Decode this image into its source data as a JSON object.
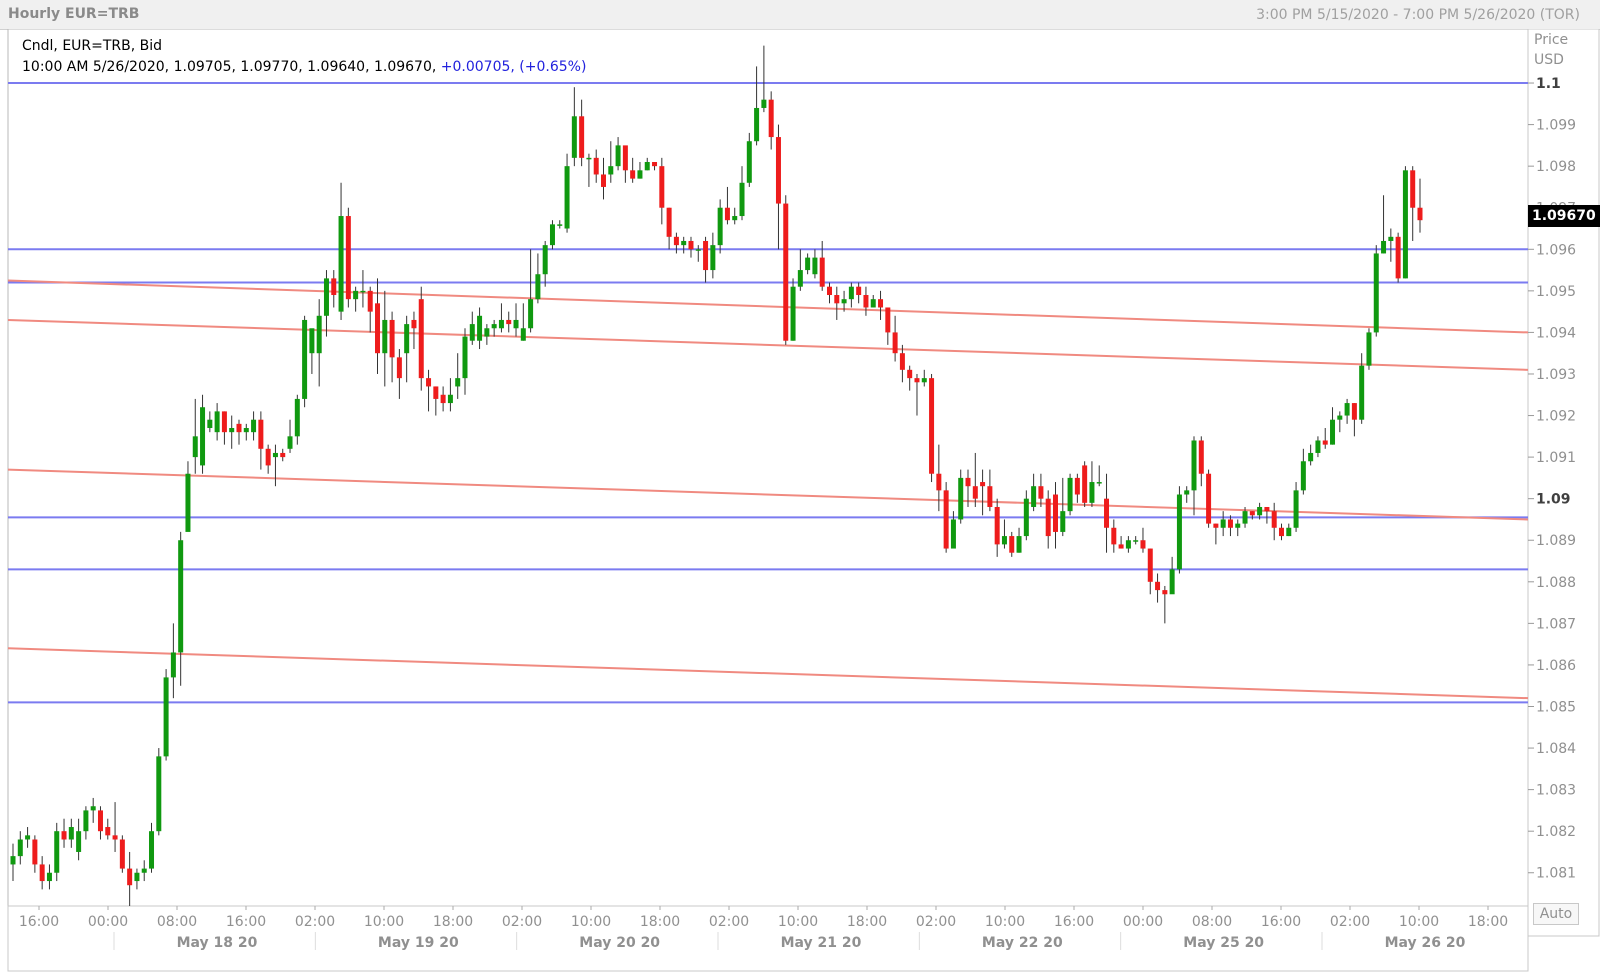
{
  "header": {
    "title": "Hourly EUR=TRB",
    "range": "3:00 PM 5/15/2020 - 7:00 PM 5/26/2020 (TOR)"
  },
  "legend": {
    "line1": "Cndl, EUR=TRB, Bid",
    "line2_prefix": "10:00 AM 5/26/2020, 1.09705, 1.09770, 1.09640, 1.09670, ",
    "line2_change": "+0.00705, (+0.65%)"
  },
  "price_axis": {
    "header_line1": "Price",
    "header_line2": "USD",
    "last_price": "1.09670",
    "auto_label": "Auto"
  },
  "chart_data": {
    "type": "candlestick",
    "symbol": "EUR=TRB",
    "interval": "Hourly",
    "ylim": [
      1.0802,
      1.1013
    ],
    "ytick_values": [
      1.081,
      1.082,
      1.083,
      1.084,
      1.085,
      1.086,
      1.087,
      1.088,
      1.089,
      1.09,
      1.091,
      1.092,
      1.093,
      1.094,
      1.095,
      1.096,
      1.097,
      1.098,
      1.099,
      1.1
    ],
    "ytick_labels": [
      "1.081",
      "1.082",
      "1.083",
      "1.084",
      "1.085",
      "1.086",
      "1.087",
      "1.088",
      "1.089",
      "1.09",
      "1.091",
      "1.092",
      "1.093",
      "1.094",
      "1.095",
      "1.096",
      "1.097",
      "1.098",
      "1.099",
      "1.1"
    ],
    "bold_ticks": [
      "1.09",
      "1.1"
    ],
    "time_ticks": [
      "16:00",
      "00:00",
      "08:00",
      "16:00",
      "02:00",
      "10:00",
      "18:00",
      "02:00",
      "10:00",
      "18:00",
      "02:00",
      "10:00",
      "18:00",
      "02:00",
      "10:00",
      "16:00",
      "00:00",
      "08:00",
      "16:00",
      "02:00",
      "10:00",
      "18:00"
    ],
    "date_labels": [
      "May 18 20",
      "May 19 20",
      "May 20 20",
      "May 21 20",
      "May 22 20",
      "May 25 20",
      "May 26 20"
    ],
    "horizontal_lines": [
      1.1,
      1.096,
      1.0952,
      1.08955,
      1.0883,
      1.0851
    ],
    "trend_lines": [
      {
        "start": 1.09525,
        "end": 1.094
      },
      {
        "start": 1.0943,
        "end": 1.0931
      },
      {
        "start": 1.0907,
        "end": 1.0895
      },
      {
        "start": 1.0864,
        "end": 1.0852
      }
    ],
    "candles": [
      [
        1.0812,
        1.0814,
        1.0808,
        1.0817
      ],
      [
        1.0814,
        1.0818,
        1.0812,
        1.082
      ],
      [
        1.0818,
        1.0819,
        1.0816,
        1.0821
      ],
      [
        1.0818,
        1.0812,
        1.081,
        1.0819
      ],
      [
        1.0812,
        1.0808,
        1.0806,
        1.0814
      ],
      [
        1.0808,
        1.081,
        1.0806,
        1.0812
      ],
      [
        1.081,
        1.082,
        1.0808,
        1.0822
      ],
      [
        1.082,
        1.0818,
        1.0816,
        1.0823
      ],
      [
        1.0818,
        1.0821,
        1.0816,
        1.0823
      ],
      [
        1.0815,
        1.082,
        1.0813,
        1.0823
      ],
      [
        1.082,
        1.0825,
        1.0818,
        1.0826
      ],
      [
        1.0825,
        1.0826,
        1.0822,
        1.0828
      ],
      [
        1.0825,
        1.082,
        1.0818,
        1.0826
      ],
      [
        1.0821,
        1.0819,
        1.0818,
        1.0823
      ],
      [
        1.0819,
        1.0818,
        1.0815,
        1.0827
      ],
      [
        1.0818,
        1.0811,
        1.081,
        1.0819
      ],
      [
        1.0811,
        1.0807,
        1.0802,
        1.0815
      ],
      [
        1.0808,
        1.081,
        1.0806,
        1.0811
      ],
      [
        1.081,
        1.0811,
        1.0808,
        1.0813
      ],
      [
        1.0811,
        1.082,
        1.081,
        1.0822
      ],
      [
        1.082,
        1.0838,
        1.0819,
        1.084
      ],
      [
        1.0838,
        1.0857,
        1.0837,
        1.0859
      ],
      [
        1.0857,
        1.0863,
        1.0852,
        1.087
      ],
      [
        1.0863,
        1.089,
        1.0855,
        1.0892
      ],
      [
        1.0892,
        1.0906,
        1.0903,
        1.0909
      ],
      [
        1.091,
        1.0915,
        1.0906,
        1.0924
      ],
      [
        1.0908,
        1.0922,
        1.0906,
        1.0925
      ],
      [
        1.0917,
        1.0919,
        1.0916,
        1.0921
      ],
      [
        1.0916,
        1.0921,
        1.0914,
        1.0923
      ],
      [
        1.0921,
        1.0916,
        1.0913,
        1.0921
      ],
      [
        1.0916,
        1.0917,
        1.0912,
        1.092
      ],
      [
        1.0918,
        1.0916,
        1.0913,
        1.0919
      ],
      [
        1.0916,
        1.0917,
        1.0914,
        1.0918
      ],
      [
        1.0916,
        1.0919,
        1.0914,
        1.0921
      ],
      [
        1.0919,
        1.0912,
        1.0907,
        1.0921
      ],
      [
        1.0912,
        1.0908,
        1.0906,
        1.0913
      ],
      [
        1.091,
        1.0911,
        1.0903,
        1.0913
      ],
      [
        1.0911,
        1.091,
        1.0909,
        1.0912
      ],
      [
        1.0912,
        1.0915,
        1.0911,
        1.0919
      ],
      [
        1.0915,
        1.0924,
        1.0913,
        1.0925
      ],
      [
        1.0924,
        1.0943,
        1.0922,
        1.0944
      ],
      [
        1.0935,
        1.0941,
        1.093,
        1.0939
      ],
      [
        1.0935,
        1.0944,
        1.0927,
        1.0948
      ],
      [
        1.0944,
        1.0953,
        1.0939,
        1.0955
      ],
      [
        1.0953,
        1.0949,
        1.0946,
        1.0955
      ],
      [
        1.0945,
        1.0968,
        1.0943,
        1.0976
      ],
      [
        1.0968,
        1.0948,
        1.0946,
        1.097
      ],
      [
        1.0948,
        1.095,
        1.0945,
        1.0951
      ],
      [
        1.095,
        1.095,
        1.0946,
        1.0955
      ],
      [
        1.095,
        1.0945,
        1.094,
        1.0951
      ],
      [
        1.0947,
        1.0935,
        1.093,
        1.0953
      ],
      [
        1.0935,
        1.0943,
        1.0927,
        1.095
      ],
      [
        1.0943,
        1.0934,
        1.0928,
        1.0945
      ],
      [
        1.0934,
        1.0929,
        1.0924,
        1.0936
      ],
      [
        1.0935,
        1.0942,
        1.0928,
        1.0944
      ],
      [
        1.0943,
        1.0941,
        1.0936,
        1.0945
      ],
      [
        1.0948,
        1.0929,
        1.0926,
        1.0951
      ],
      [
        1.0929,
        1.0927,
        1.0921,
        1.0931
      ],
      [
        1.0927,
        1.0924,
        1.092,
        1.0927
      ],
      [
        1.0925,
        1.0923,
        1.0921,
        1.0927
      ],
      [
        1.0923,
        1.0925,
        1.0921,
        1.0929
      ],
      [
        1.0927,
        1.0929,
        1.0924,
        1.0935
      ],
      [
        1.0929,
        1.0939,
        1.0925,
        1.0941
      ],
      [
        1.0938,
        1.0942,
        1.0937,
        1.0945
      ],
      [
        1.0938,
        1.0944,
        1.0936,
        1.0946
      ],
      [
        1.0939,
        1.0941,
        1.0937,
        1.0942
      ],
      [
        1.0941,
        1.0942,
        1.0939,
        1.0943
      ],
      [
        1.0941,
        1.0943,
        1.094,
        1.0947
      ],
      [
        1.0943,
        1.0942,
        1.094,
        1.0945
      ],
      [
        1.0941,
        1.0943,
        1.0939,
        1.0947
      ],
      [
        1.0938,
        1.0941,
        1.0938,
        1.0947
      ],
      [
        1.0941,
        1.0948,
        1.094,
        1.096
      ],
      [
        1.0948,
        1.0954,
        1.0947,
        1.0959
      ],
      [
        1.0954,
        1.0961,
        1.0951,
        1.0962
      ],
      [
        1.0961,
        1.0966,
        1.096,
        1.0967
      ],
      [
        1.0966,
        1.0966,
        1.0965,
        1.0967
      ],
      [
        1.0965,
        1.098,
        1.0964,
        1.0983
      ],
      [
        1.0982,
        1.0992,
        1.098,
        1.0999
      ],
      [
        1.0992,
        1.0982,
        1.098,
        1.0996
      ],
      [
        1.0982,
        1.0982,
        1.0975,
        1.0983
      ],
      [
        1.0982,
        1.0978,
        1.0976,
        1.0984
      ],
      [
        1.0978,
        1.0975,
        1.0972,
        1.0982
      ],
      [
        1.0978,
        1.098,
        1.0976,
        1.0986
      ],
      [
        1.098,
        1.0985,
        1.0979,
        1.0987
      ],
      [
        1.0985,
        1.0979,
        1.0976,
        1.0984
      ],
      [
        1.0979,
        1.0977,
        1.0976,
        1.0982
      ],
      [
        1.0977,
        1.0979,
        1.0977,
        1.0981
      ],
      [
        1.0979,
        1.0981,
        1.0979,
        1.0982
      ],
      [
        1.0981,
        1.098,
        1.0979,
        1.0981
      ],
      [
        1.098,
        1.097,
        1.0966,
        1.0982
      ],
      [
        1.097,
        1.0963,
        1.096,
        1.097
      ],
      [
        1.0963,
        1.0961,
        1.0959,
        1.0964
      ],
      [
        1.0961,
        1.0962,
        1.0959,
        1.0963
      ],
      [
        1.0962,
        1.096,
        1.0958,
        1.0963
      ],
      [
        1.096,
        1.096,
        1.0957,
        1.0961
      ],
      [
        1.0962,
        1.0955,
        1.0952,
        1.0963
      ],
      [
        1.0955,
        1.0961,
        1.0953,
        1.0964
      ],
      [
        1.0961,
        1.097,
        1.0959,
        1.0972
      ],
      [
        1.097,
        1.0967,
        1.0966,
        1.0975
      ],
      [
        1.0967,
        1.0968,
        1.0966,
        1.097
      ],
      [
        1.0968,
        1.0976,
        1.0967,
        1.098
      ],
      [
        1.0976,
        1.0986,
        1.0975,
        1.0988
      ],
      [
        1.0986,
        1.0994,
        1.0985,
        1.1004
      ],
      [
        1.0994,
        1.0996,
        1.0993,
        1.1009
      ],
      [
        1.0996,
        1.0987,
        1.0984,
        1.0998
      ],
      [
        1.0987,
        1.0971,
        1.096,
        1.099
      ],
      [
        1.0971,
        1.0938,
        1.0937,
        1.0973
      ],
      [
        1.0938,
        1.0951,
        1.0938,
        1.0953
      ],
      [
        1.0951,
        1.0955,
        1.095,
        1.096
      ],
      [
        1.0955,
        1.0958,
        1.0954,
        1.0959
      ],
      [
        1.0954,
        1.0958,
        1.0953,
        1.096
      ],
      [
        1.0958,
        1.0951,
        1.095,
        1.0962
      ],
      [
        1.0951,
        1.0949,
        1.0947,
        1.0952
      ],
      [
        1.0949,
        1.0947,
        1.0943,
        1.0951
      ],
      [
        1.0947,
        1.0948,
        1.0945,
        1.095
      ],
      [
        1.0948,
        1.0951,
        1.0946,
        1.0952
      ],
      [
        1.0951,
        1.0949,
        1.0947,
        1.0952
      ],
      [
        1.0949,
        1.0946,
        1.0944,
        1.0951
      ],
      [
        1.0946,
        1.0948,
        1.0946,
        1.0949
      ],
      [
        1.0948,
        1.0946,
        1.0943,
        1.095
      ],
      [
        1.0946,
        1.094,
        1.0937,
        1.0946
      ],
      [
        1.094,
        1.0935,
        1.0933,
        1.0944
      ],
      [
        1.0935,
        1.0931,
        1.0928,
        1.0937
      ],
      [
        1.0931,
        1.0929,
        1.0926,
        1.0932
      ],
      [
        1.0929,
        1.0928,
        1.092,
        1.093
      ],
      [
        1.0928,
        1.0929,
        1.0927,
        1.0931
      ],
      [
        1.0929,
        1.0906,
        1.0904,
        1.093
      ],
      [
        1.0906,
        1.0902,
        1.0897,
        1.0913
      ],
      [
        1.0902,
        1.0888,
        1.0887,
        1.0904
      ],
      [
        1.0888,
        1.0895,
        1.0889,
        1.0897
      ],
      [
        1.0895,
        1.0905,
        1.0894,
        1.0907
      ],
      [
        1.0905,
        1.0903,
        1.0898,
        1.0907
      ],
      [
        1.0903,
        1.09,
        1.0898,
        1.0911
      ],
      [
        1.0904,
        1.0903,
        1.0896,
        1.0907
      ],
      [
        1.0903,
        1.0898,
        1.0897,
        1.0907
      ],
      [
        1.0898,
        1.0889,
        1.0886,
        1.09
      ],
      [
        1.0889,
        1.0891,
        1.0888,
        1.0895
      ],
      [
        1.0891,
        1.0887,
        1.0886,
        1.0892
      ],
      [
        1.0887,
        1.0891,
        1.0887,
        1.0893
      ],
      [
        1.0891,
        1.09,
        1.089,
        1.0902
      ],
      [
        1.0898,
        1.0903,
        1.0897,
        1.0906
      ],
      [
        1.0903,
        1.09,
        1.0898,
        1.0906
      ],
      [
        1.09,
        1.0891,
        1.0888,
        1.0902
      ],
      [
        1.0901,
        1.0892,
        1.0888,
        1.0904
      ],
      [
        1.0892,
        1.0897,
        1.0891,
        1.0905
      ],
      [
        1.0897,
        1.0905,
        1.0896,
        1.0906
      ],
      [
        1.0905,
        1.0901,
        1.0899,
        1.0906
      ],
      [
        1.0908,
        1.0899,
        1.0898,
        1.0909
      ],
      [
        1.0899,
        1.0904,
        1.0898,
        1.0909
      ],
      [
        1.0904,
        1.0904,
        1.0903,
        1.0908
      ],
      [
        1.09,
        1.0893,
        1.0887,
        1.0906
      ],
      [
        1.0893,
        1.0889,
        1.0887,
        1.0895
      ],
      [
        1.0889,
        1.0888,
        1.0888,
        1.0891
      ],
      [
        1.0888,
        1.089,
        1.0887,
        1.0891
      ],
      [
        1.089,
        1.089,
        1.0889,
        1.0891
      ],
      [
        1.089,
        1.0888,
        1.0887,
        1.0893
      ],
      [
        1.0888,
        1.088,
        1.0877,
        1.0888
      ],
      [
        1.088,
        1.0878,
        1.0875,
        1.0882
      ],
      [
        1.0878,
        1.0877,
        1.087,
        1.0879
      ],
      [
        1.0877,
        1.0883,
        1.0878,
        1.0886
      ],
      [
        1.0883,
        1.0901,
        1.0882,
        1.0903
      ],
      [
        1.0901,
        1.0902,
        1.0899,
        1.0903
      ],
      [
        1.0902,
        1.0914,
        1.0896,
        1.0915
      ],
      [
        1.0914,
        1.0906,
        1.0903,
        1.0915
      ],
      [
        1.0906,
        1.0894,
        1.0893,
        1.0907
      ],
      [
        1.0894,
        1.0893,
        1.0889,
        1.0894
      ],
      [
        1.0893,
        1.0895,
        1.0891,
        1.0897
      ],
      [
        1.0895,
        1.0893,
        1.0891,
        1.0896
      ],
      [
        1.0893,
        1.0894,
        1.0891,
        1.0895
      ],
      [
        1.0894,
        1.0897,
        1.0893,
        1.0898
      ],
      [
        1.0897,
        1.0896,
        1.0895,
        1.0897
      ],
      [
        1.0896,
        1.0898,
        1.0895,
        1.0899
      ],
      [
        1.0898,
        1.0897,
        1.0894,
        1.0898
      ],
      [
        1.0897,
        1.0893,
        1.089,
        1.0899
      ],
      [
        1.0893,
        1.0891,
        1.089,
        1.0894
      ],
      [
        1.0891,
        1.0893,
        1.0891,
        1.0894
      ],
      [
        1.0893,
        1.0902,
        1.0892,
        1.0904
      ],
      [
        1.0902,
        1.0909,
        1.0901,
        1.0912
      ],
      [
        1.0909,
        1.0911,
        1.0908,
        1.0913
      ],
      [
        1.0911,
        1.0914,
        1.091,
        1.0915
      ],
      [
        1.0914,
        1.0913,
        1.0912,
        1.0917
      ],
      [
        1.0913,
        1.0919,
        1.0913,
        1.0922
      ],
      [
        1.0919,
        1.092,
        1.0916,
        1.0921
      ],
      [
        1.092,
        1.0923,
        1.0918,
        1.0924
      ],
      [
        1.0923,
        1.0919,
        1.0915,
        1.0923
      ],
      [
        1.0919,
        1.0932,
        1.0918,
        1.0935
      ],
      [
        1.0932,
        1.094,
        1.0931,
        1.0941
      ],
      [
        1.094,
        1.0959,
        1.0939,
        1.0961
      ],
      [
        1.0959,
        1.0962,
        1.0959,
        1.0973
      ],
      [
        1.0962,
        1.0963,
        1.0957,
        1.0965
      ],
      [
        1.0963,
        1.0953,
        1.0952,
        1.0964
      ],
      [
        1.0953,
        1.0979,
        1.0953,
        1.098
      ],
      [
        1.0979,
        1.097,
        1.0962,
        1.098
      ],
      [
        1.097,
        1.0967,
        1.0964,
        1.0977
      ]
    ]
  }
}
